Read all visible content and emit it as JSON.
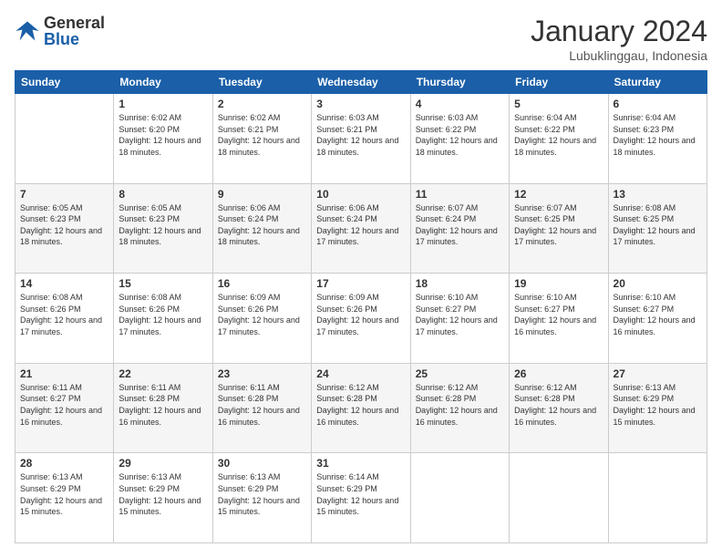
{
  "logo": {
    "text_general": "General",
    "text_blue": "Blue"
  },
  "header": {
    "month": "January 2024",
    "location": "Lubuklinggau, Indonesia"
  },
  "weekdays": [
    "Sunday",
    "Monday",
    "Tuesday",
    "Wednesday",
    "Thursday",
    "Friday",
    "Saturday"
  ],
  "weeks": [
    [
      {
        "day": "",
        "sunrise": "",
        "sunset": "",
        "daylight": ""
      },
      {
        "day": "1",
        "sunrise": "6:02 AM",
        "sunset": "6:20 PM",
        "daylight": "12 hours and 18 minutes."
      },
      {
        "day": "2",
        "sunrise": "6:02 AM",
        "sunset": "6:21 PM",
        "daylight": "12 hours and 18 minutes."
      },
      {
        "day": "3",
        "sunrise": "6:03 AM",
        "sunset": "6:21 PM",
        "daylight": "12 hours and 18 minutes."
      },
      {
        "day": "4",
        "sunrise": "6:03 AM",
        "sunset": "6:22 PM",
        "daylight": "12 hours and 18 minutes."
      },
      {
        "day": "5",
        "sunrise": "6:04 AM",
        "sunset": "6:22 PM",
        "daylight": "12 hours and 18 minutes."
      },
      {
        "day": "6",
        "sunrise": "6:04 AM",
        "sunset": "6:23 PM",
        "daylight": "12 hours and 18 minutes."
      }
    ],
    [
      {
        "day": "7",
        "sunrise": "6:05 AM",
        "sunset": "6:23 PM",
        "daylight": "12 hours and 18 minutes."
      },
      {
        "day": "8",
        "sunrise": "6:05 AM",
        "sunset": "6:23 PM",
        "daylight": "12 hours and 18 minutes."
      },
      {
        "day": "9",
        "sunrise": "6:06 AM",
        "sunset": "6:24 PM",
        "daylight": "12 hours and 18 minutes."
      },
      {
        "day": "10",
        "sunrise": "6:06 AM",
        "sunset": "6:24 PM",
        "daylight": "12 hours and 17 minutes."
      },
      {
        "day": "11",
        "sunrise": "6:07 AM",
        "sunset": "6:24 PM",
        "daylight": "12 hours and 17 minutes."
      },
      {
        "day": "12",
        "sunrise": "6:07 AM",
        "sunset": "6:25 PM",
        "daylight": "12 hours and 17 minutes."
      },
      {
        "day": "13",
        "sunrise": "6:08 AM",
        "sunset": "6:25 PM",
        "daylight": "12 hours and 17 minutes."
      }
    ],
    [
      {
        "day": "14",
        "sunrise": "6:08 AM",
        "sunset": "6:26 PM",
        "daylight": "12 hours and 17 minutes."
      },
      {
        "day": "15",
        "sunrise": "6:08 AM",
        "sunset": "6:26 PM",
        "daylight": "12 hours and 17 minutes."
      },
      {
        "day": "16",
        "sunrise": "6:09 AM",
        "sunset": "6:26 PM",
        "daylight": "12 hours and 17 minutes."
      },
      {
        "day": "17",
        "sunrise": "6:09 AM",
        "sunset": "6:26 PM",
        "daylight": "12 hours and 17 minutes."
      },
      {
        "day": "18",
        "sunrise": "6:10 AM",
        "sunset": "6:27 PM",
        "daylight": "12 hours and 17 minutes."
      },
      {
        "day": "19",
        "sunrise": "6:10 AM",
        "sunset": "6:27 PM",
        "daylight": "12 hours and 16 minutes."
      },
      {
        "day": "20",
        "sunrise": "6:10 AM",
        "sunset": "6:27 PM",
        "daylight": "12 hours and 16 minutes."
      }
    ],
    [
      {
        "day": "21",
        "sunrise": "6:11 AM",
        "sunset": "6:27 PM",
        "daylight": "12 hours and 16 minutes."
      },
      {
        "day": "22",
        "sunrise": "6:11 AM",
        "sunset": "6:28 PM",
        "daylight": "12 hours and 16 minutes."
      },
      {
        "day": "23",
        "sunrise": "6:11 AM",
        "sunset": "6:28 PM",
        "daylight": "12 hours and 16 minutes."
      },
      {
        "day": "24",
        "sunrise": "6:12 AM",
        "sunset": "6:28 PM",
        "daylight": "12 hours and 16 minutes."
      },
      {
        "day": "25",
        "sunrise": "6:12 AM",
        "sunset": "6:28 PM",
        "daylight": "12 hours and 16 minutes."
      },
      {
        "day": "26",
        "sunrise": "6:12 AM",
        "sunset": "6:28 PM",
        "daylight": "12 hours and 16 minutes."
      },
      {
        "day": "27",
        "sunrise": "6:13 AM",
        "sunset": "6:29 PM",
        "daylight": "12 hours and 15 minutes."
      }
    ],
    [
      {
        "day": "28",
        "sunrise": "6:13 AM",
        "sunset": "6:29 PM",
        "daylight": "12 hours and 15 minutes."
      },
      {
        "day": "29",
        "sunrise": "6:13 AM",
        "sunset": "6:29 PM",
        "daylight": "12 hours and 15 minutes."
      },
      {
        "day": "30",
        "sunrise": "6:13 AM",
        "sunset": "6:29 PM",
        "daylight": "12 hours and 15 minutes."
      },
      {
        "day": "31",
        "sunrise": "6:14 AM",
        "sunset": "6:29 PM",
        "daylight": "12 hours and 15 minutes."
      },
      {
        "day": "",
        "sunrise": "",
        "sunset": "",
        "daylight": ""
      },
      {
        "day": "",
        "sunrise": "",
        "sunset": "",
        "daylight": ""
      },
      {
        "day": "",
        "sunrise": "",
        "sunset": "",
        "daylight": ""
      }
    ]
  ]
}
